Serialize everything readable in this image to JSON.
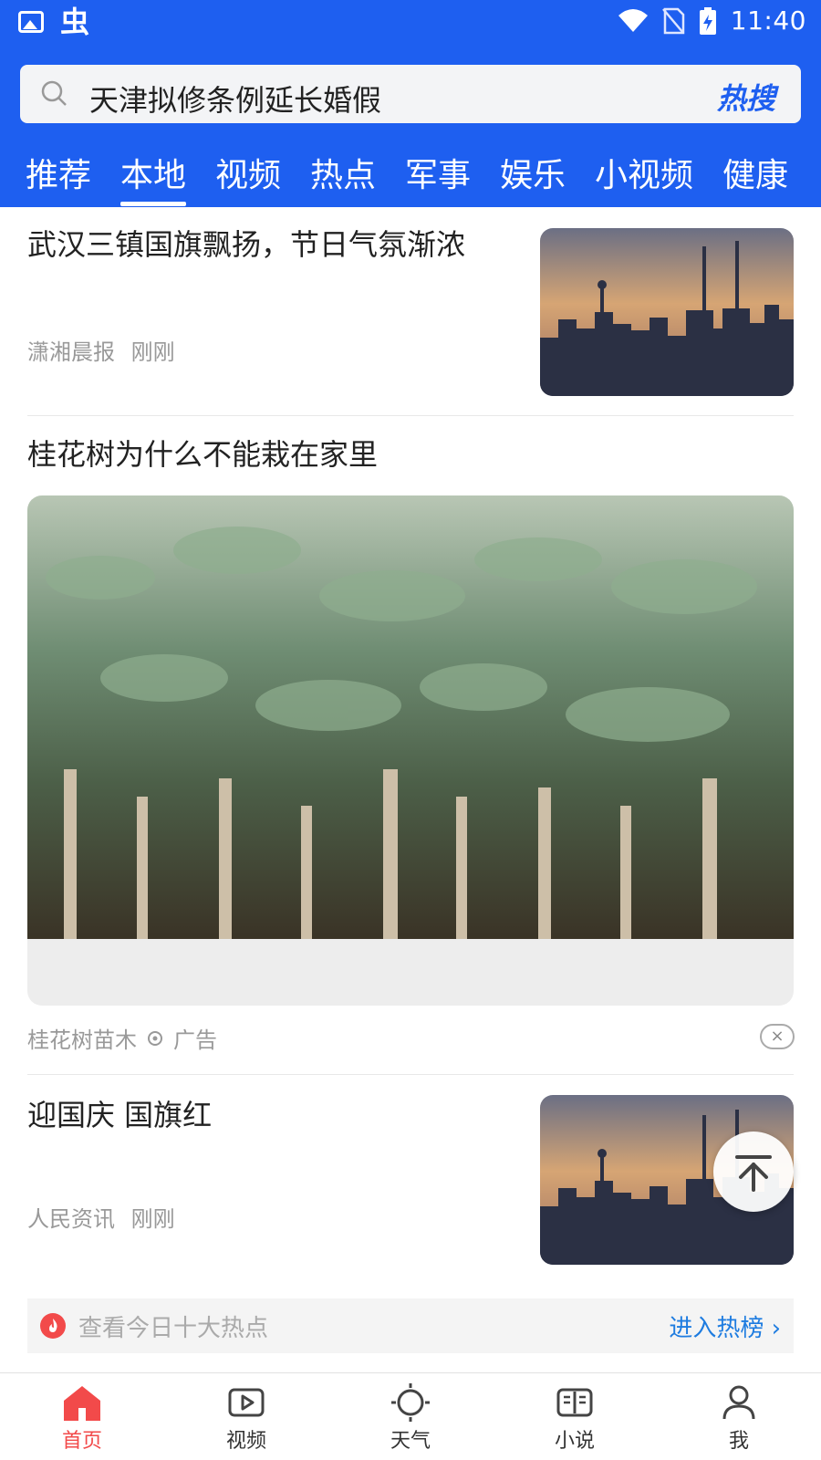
{
  "status_bar": {
    "time": "11:40"
  },
  "search": {
    "text": "天津拟修条例延长婚假",
    "hot_label": "热搜"
  },
  "tabs": [
    "推荐",
    "本地",
    "视频",
    "热点",
    "军事",
    "娱乐",
    "小视频",
    "健康"
  ],
  "active_tab": "本地",
  "feed": {
    "item1": {
      "title": "武汉三镇国旗飘扬，节日气氛渐浓",
      "source": "潇湘晨报",
      "time": "刚刚"
    },
    "ad": {
      "title": "桂花树为什么不能栽在家里",
      "advertiser": "桂花树苗木",
      "ad_label": "广告",
      "close_glyph": "×"
    },
    "item2": {
      "title": "迎国庆 国旗红",
      "source": "人民资讯",
      "time": "刚刚"
    }
  },
  "hot_bar": {
    "text": "查看今日十大热点",
    "link": "进入热榜 ›"
  },
  "bottom_nav": {
    "items": [
      {
        "label": "首页",
        "icon": "home-icon",
        "active": true
      },
      {
        "label": "视频",
        "icon": "video-icon",
        "active": false
      },
      {
        "label": "天气",
        "icon": "weather-icon",
        "active": false
      },
      {
        "label": "小说",
        "icon": "novel-icon",
        "active": false
      },
      {
        "label": "我",
        "icon": "profile-icon",
        "active": false
      }
    ]
  },
  "colors": {
    "brand": "#1e5ff0",
    "active_nav": "#f24a4a",
    "link": "#1e7ce0"
  }
}
